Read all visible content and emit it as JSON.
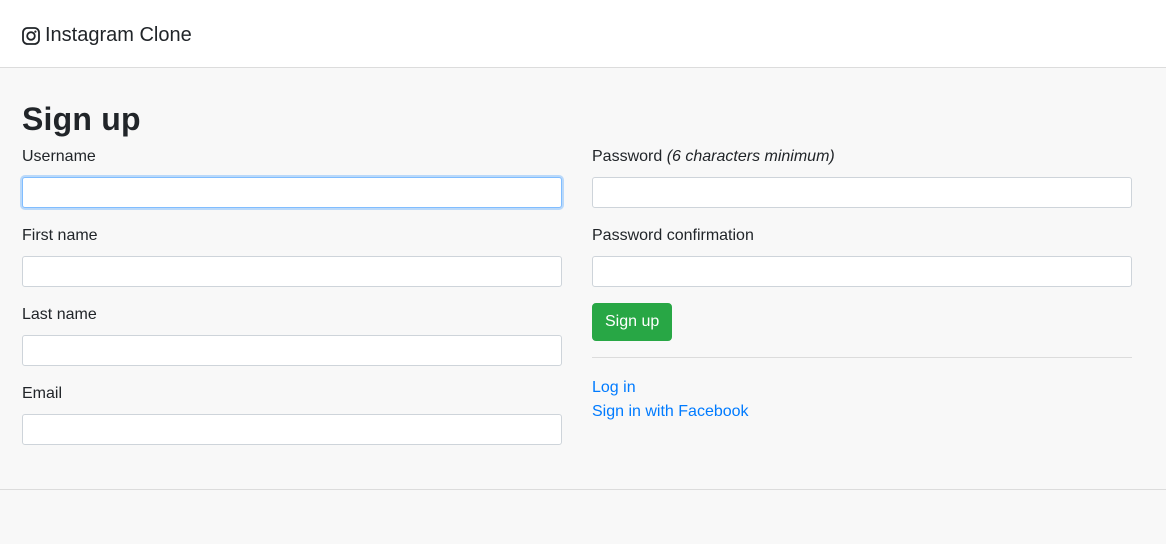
{
  "navbar": {
    "brand_label": "Instagram Clone",
    "brand_icon": "instagram-icon"
  },
  "page": {
    "title": "Sign up"
  },
  "form": {
    "username": {
      "label": "Username",
      "value": "",
      "placeholder": ""
    },
    "first_name": {
      "label": "First name",
      "value": "",
      "placeholder": ""
    },
    "last_name": {
      "label": "Last name",
      "value": "",
      "placeholder": ""
    },
    "email": {
      "label": "Email",
      "value": "",
      "placeholder": ""
    },
    "password": {
      "label": "Password",
      "hint": "(6 characters minimum)",
      "value": "",
      "placeholder": ""
    },
    "password_confirmation": {
      "label": "Password confirmation",
      "value": "",
      "placeholder": ""
    },
    "submit_label": "Sign up"
  },
  "links": {
    "login": "Log in",
    "facebook": "Sign in with Facebook"
  },
  "colors": {
    "primary_link": "#007bff",
    "success": "#28a745",
    "focus_border": "#80bdff"
  }
}
